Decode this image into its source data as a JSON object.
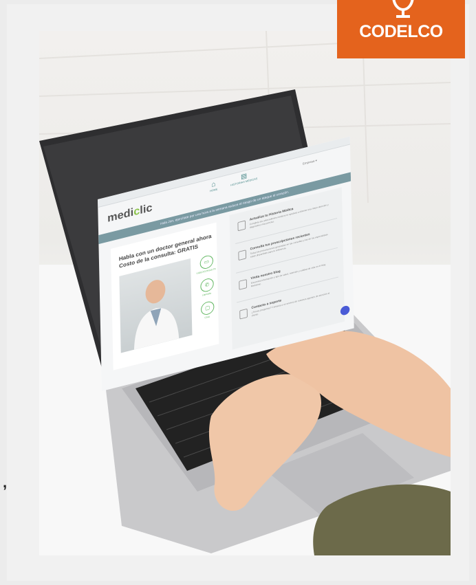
{
  "logo": {
    "text": "CODELCO",
    "brand_color": "#e4631d"
  },
  "stray_mark": ",",
  "screen": {
    "brand": {
      "prefix": "medi",
      "accent": "c",
      "suffix": "lic"
    },
    "nav": [
      {
        "label": "HOME",
        "icon": "home-icon"
      },
      {
        "label": "HISTORIAS MÉDICAS",
        "icon": "document-icon"
      }
    ],
    "company_select": "Empresa",
    "banner_text": "Hola Jon, ejercítate por una hora a la semana reduce el riesgo de un ataque al corazón.",
    "card": {
      "title_line1": "Habla con un doctor general ahora",
      "title_line2": "Costo de la consulta: GRATIS",
      "buttons": [
        {
          "label": "VIDEOCONSULTA",
          "icon": "video-icon"
        },
        {
          "label": "Llamada",
          "icon": "phone-icon"
        },
        {
          "label": "Chat",
          "icon": "chat-icon"
        }
      ]
    },
    "items": [
      {
        "title": "Actualiza tu Historia Médica",
        "text": "Completa tus antecedentes médicos te ayudará a obtener una mejor atención y diagnóstico más preciso.",
        "icon": "clipboard-icon"
      },
      {
        "title": "Consulta tus prescripciones recientes",
        "text": "Todas las prescripciones generadas en las consultas y las de los especialistas están disponibles para tu referencia.",
        "icon": "prescription-icon"
      },
      {
        "title": "Visita nuestro blog",
        "text": "Encuentra información y tips de salud, nutrición y calidad de vida en el blog Mediclinic.",
        "icon": "blog-icon"
      },
      {
        "title": "Contacto a soporte",
        "text": "¿Tienes preguntas? Contacta a un servicio de nuestros agentes de atención al cliente.",
        "icon": "support-icon"
      }
    ],
    "chat_fab_icon": "chat-bubble-icon"
  }
}
